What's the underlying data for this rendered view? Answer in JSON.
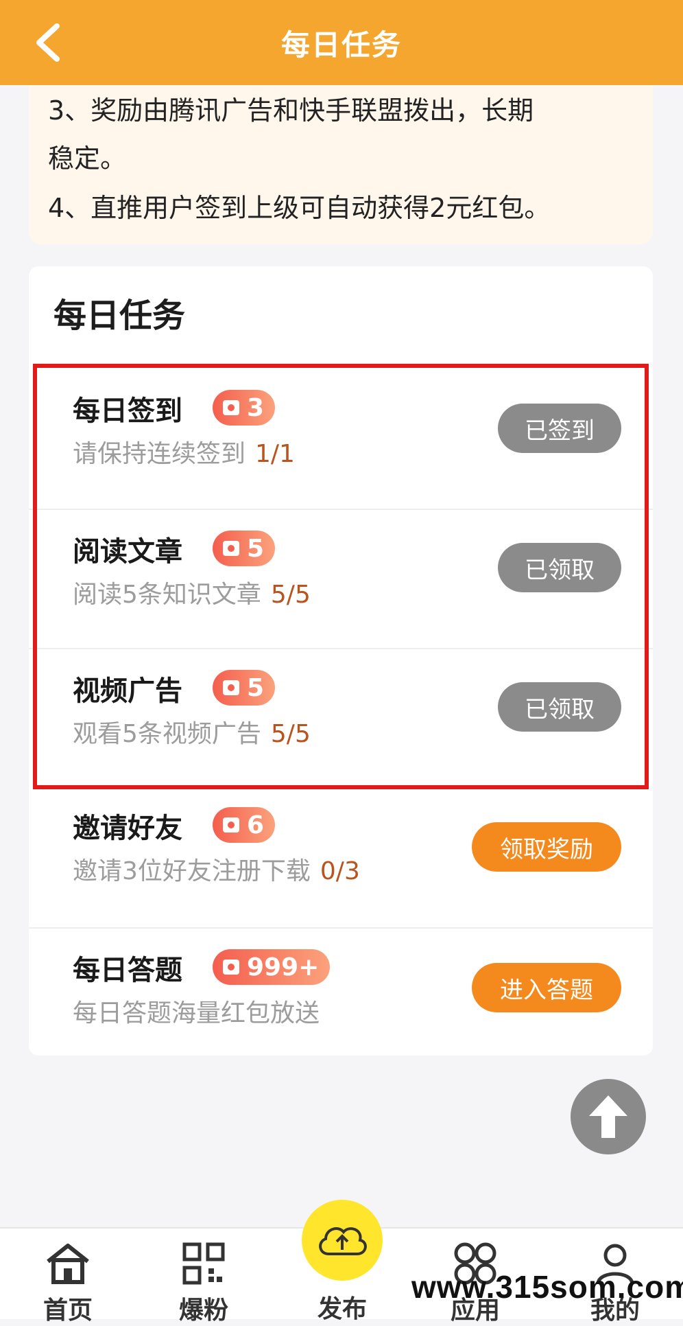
{
  "header": {
    "title": "每日任务"
  },
  "notice": {
    "lines": [
      "3、奖励由腾讯广告和快手联盟拨出，长期",
      "稳定。",
      "4、直推用户签到上级可自动获得2元红包。"
    ]
  },
  "section_title": "每日任务",
  "tasks": [
    {
      "name": "每日签到",
      "reward": "3",
      "desc": "请保持连续签到",
      "progress": "1/1",
      "button": "已签到",
      "button_state": "done"
    },
    {
      "name": "阅读文章",
      "reward": "5",
      "desc": "阅读5条知识文章",
      "progress": "5/5",
      "button": "已领取",
      "button_state": "done"
    },
    {
      "name": "视频广告",
      "reward": "5",
      "desc": "观看5条视频广告",
      "progress": "5/5",
      "button": "已领取",
      "button_state": "done"
    },
    {
      "name": "邀请好友",
      "reward": "6",
      "desc": "邀请3位好友注册下载",
      "progress": "0/3",
      "button": "领取奖励",
      "button_state": "active"
    },
    {
      "name": "每日答题",
      "reward": "999+",
      "desc": "每日答题海量红包放送",
      "progress": "",
      "button": "进入答题",
      "button_state": "active"
    }
  ],
  "tabbar": {
    "home": "首页",
    "fans": "爆粉",
    "publish": "发布",
    "apps": "应用",
    "mine": "我的"
  },
  "watermark": "www.315som.com",
  "colors": {
    "header": "#f5a62e",
    "highlight_border": "#e21a1a",
    "button_done": "#8b8b8b",
    "button_active": "#f48a1e",
    "progress_text": "#b8541e",
    "publish_button": "#ffe62d"
  }
}
